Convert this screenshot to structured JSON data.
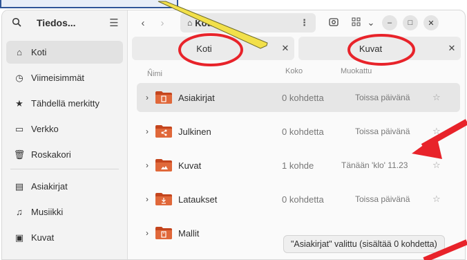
{
  "sidebar": {
    "title": "Tiedos...",
    "items_top": [
      {
        "label": "Koti",
        "icon": "home-icon",
        "active": true
      },
      {
        "label": "Viimeisimmät",
        "icon": "clock-icon"
      },
      {
        "label": "Tähdellä merkitty",
        "icon": "star-icon"
      },
      {
        "label": "Verkko",
        "icon": "network-icon"
      },
      {
        "label": "Roskakori",
        "icon": "trash-icon"
      }
    ],
    "items_bottom": [
      {
        "label": "Asiakirjat",
        "icon": "document-icon"
      },
      {
        "label": "Musiikki",
        "icon": "music-icon"
      },
      {
        "label": "Kuvat",
        "icon": "image-icon"
      }
    ]
  },
  "header": {
    "path_label": "Koti"
  },
  "tabs": [
    {
      "label": "Koti"
    },
    {
      "label": "Kuvat"
    }
  ],
  "columns": {
    "name": "Nimi",
    "size": "Koko",
    "modified": "Muokattu"
  },
  "files": [
    {
      "name": "Asiakirjat",
      "size": "0 kohdetta",
      "modified": "Toissa päivänä",
      "selected": true,
      "emblem": "document"
    },
    {
      "name": "Julkinen",
      "size": "0 kohdetta",
      "modified": "Toissa päivänä",
      "emblem": "share"
    },
    {
      "name": "Kuvat",
      "size": "1 kohde",
      "modified": "Tänään 'klo' 11.23",
      "emblem": "image"
    },
    {
      "name": "Lataukset",
      "size": "0 kohdetta",
      "modified": "Toissa päivänä",
      "emblem": "download"
    },
    {
      "name": "Mallit",
      "size": "",
      "modified": "",
      "emblem": "template"
    }
  ],
  "status_text": "\"Asiakirjat\" valittu  (sisältää 0 kohdetta)",
  "colors": {
    "folder": "#c4451d",
    "folder_tab": "#e0683a",
    "annotation_red": "#e8232a",
    "callout_border": "#2f5597",
    "arrow_yellow": "#f2e04a"
  }
}
